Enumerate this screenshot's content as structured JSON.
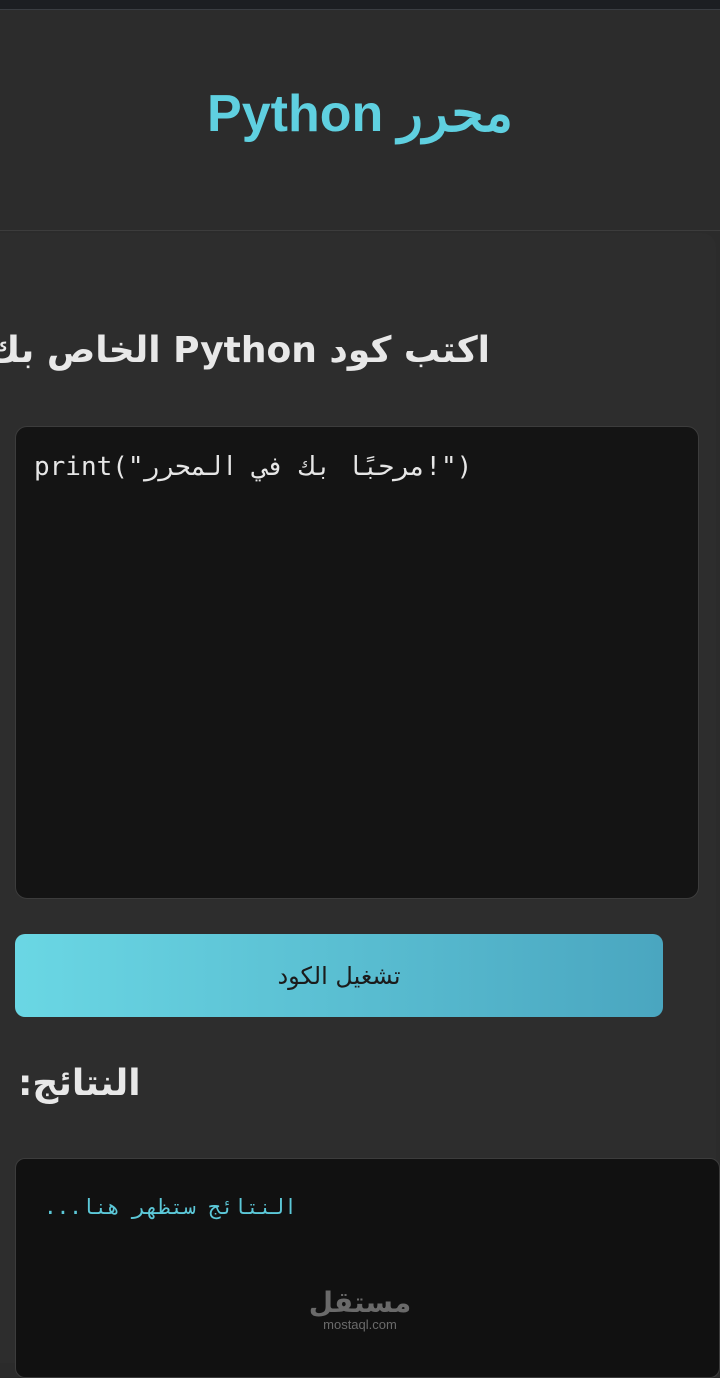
{
  "header": {
    "title": "محرر Python"
  },
  "editor_section": {
    "heading": "اكتب كود Python الخاص بك:",
    "code_value": "print(\"مرحبًا بك في المحرر!\")"
  },
  "run_button": {
    "label": "تشغيل الكود"
  },
  "results_section": {
    "heading": "النتائج:",
    "placeholder_text": "النتائج ستظهر هنا..."
  },
  "watermark": {
    "brand": "مستقل",
    "domain": "mostaql.com"
  },
  "colors": {
    "accent": "#5fd0e0",
    "background": "#2b2b2b",
    "editor_background": "#141414",
    "button_gradient_start": "#6ad7e4",
    "button_gradient_end": "#4aa6c0"
  }
}
